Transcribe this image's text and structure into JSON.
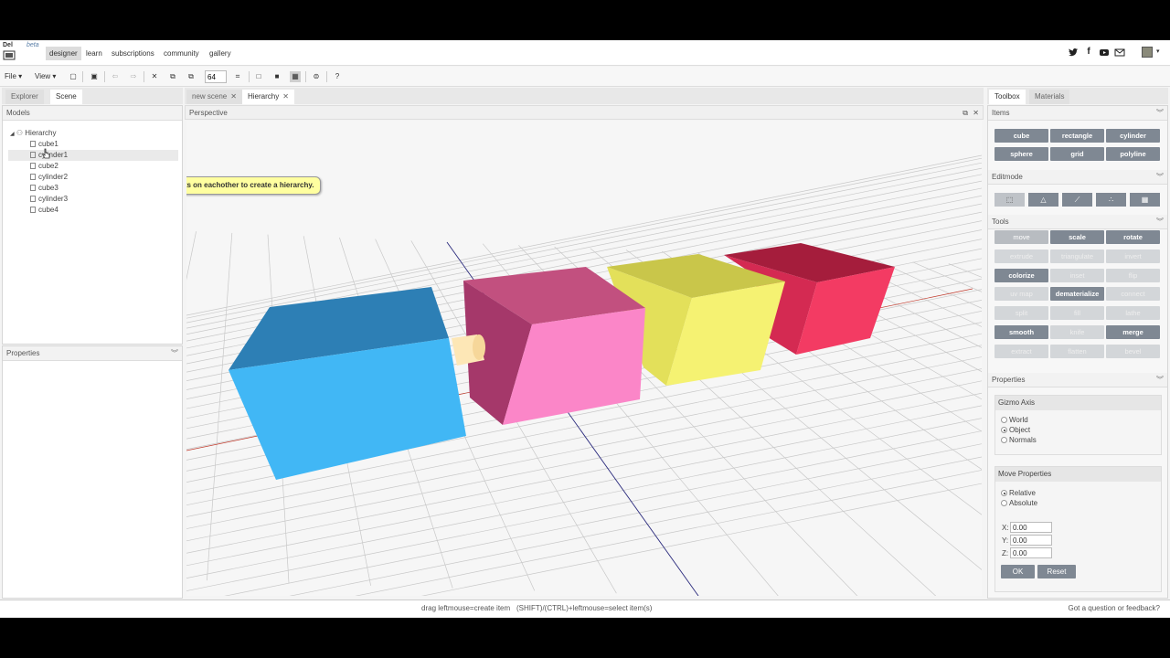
{
  "nav": {
    "logo": "Del\nRAD",
    "beta": "beta",
    "links": [
      "designer",
      "learn",
      "subscriptions",
      "community",
      "gallery"
    ],
    "active": "designer",
    "social_icons": [
      "twitter-icon",
      "facebook-icon",
      "youtube-icon",
      "mail-icon"
    ]
  },
  "toolbar": {
    "file": "File",
    "view": "View",
    "zoom_value": "64",
    "help": "?"
  },
  "left": {
    "tabs": [
      "Explorer",
      "Scene"
    ],
    "active_tab": "Scene",
    "models_header": "Models",
    "tree_root": "Hierarchy",
    "tree_items": [
      "cube1",
      "cylinder1",
      "cube2",
      "cylinder2",
      "cube3",
      "cylinder3",
      "cube4"
    ],
    "highlighted_item": "cylinder1",
    "properties_header": "Properties"
  },
  "center": {
    "tabs": [
      "new scene",
      "Hierarchy"
    ],
    "active_tab": "Hierarchy",
    "viewport_title": "Perspective",
    "tooltip": "Drag and drop objects on eachother to create a hierarchy."
  },
  "right": {
    "tabs": [
      "Toolbox",
      "Materials"
    ],
    "active_tab": "Toolbox",
    "items_header": "Items",
    "items": [
      "cube",
      "rectangle",
      "cylinder",
      "sphere",
      "grid",
      "polyline"
    ],
    "editmode_header": "Editmode",
    "editmode_icons": [
      "object-mode-icon",
      "face-mode-icon",
      "edge-mode-icon",
      "vertex-mode-icon",
      "grid-mode-icon"
    ],
    "tools_header": "Tools",
    "tools": [
      {
        "label": "move",
        "state": "hover"
      },
      {
        "label": "scale",
        "state": "dark"
      },
      {
        "label": "rotate",
        "state": "dark"
      },
      {
        "label": "extrude",
        "state": "light"
      },
      {
        "label": "triangulate",
        "state": "light"
      },
      {
        "label": "invert",
        "state": "light"
      },
      {
        "label": "colorize",
        "state": "dark"
      },
      {
        "label": "inset",
        "state": "light"
      },
      {
        "label": "flip",
        "state": "light"
      },
      {
        "label": "uv map",
        "state": "light"
      },
      {
        "label": "dematerialize",
        "state": "dark"
      },
      {
        "label": "connect",
        "state": "light"
      },
      {
        "label": "split",
        "state": "light"
      },
      {
        "label": "fill",
        "state": "light"
      },
      {
        "label": "lathe",
        "state": "light"
      },
      {
        "label": "smooth",
        "state": "dark"
      },
      {
        "label": "knife",
        "state": "light"
      },
      {
        "label": "merge",
        "state": "dark"
      },
      {
        "label": "extract",
        "state": "light"
      },
      {
        "label": "flatten",
        "state": "light"
      },
      {
        "label": "bevel",
        "state": "light"
      }
    ],
    "properties_header": "Properties",
    "gizmo_title": "Gizmo Axis",
    "gizmo_options": [
      "World",
      "Object",
      "Normals"
    ],
    "gizmo_selected": "Object",
    "move_title": "Move Properties",
    "move_options": [
      "Relative",
      "Absolute"
    ],
    "move_selected": "Relative",
    "fields": [
      {
        "label": "X:",
        "value": "0.00"
      },
      {
        "label": "Y:",
        "value": "0.00"
      },
      {
        "label": "Z:",
        "value": "0.00"
      }
    ],
    "ok": "OK",
    "reset": "Reset"
  },
  "status": {
    "hint1": "drag leftmouse=create item",
    "hint2": "(SHIFT)/(CTRL)+leftmouse=select item(s)",
    "feedback": "Got a question or feedback?"
  },
  "colors": {
    "cube_blue": "#41b7f5",
    "cube_pink": "#fb86c8",
    "cube_yellow": "#f5f272",
    "cube_red": "#f33b63",
    "cylinder": "#fde7b6"
  }
}
